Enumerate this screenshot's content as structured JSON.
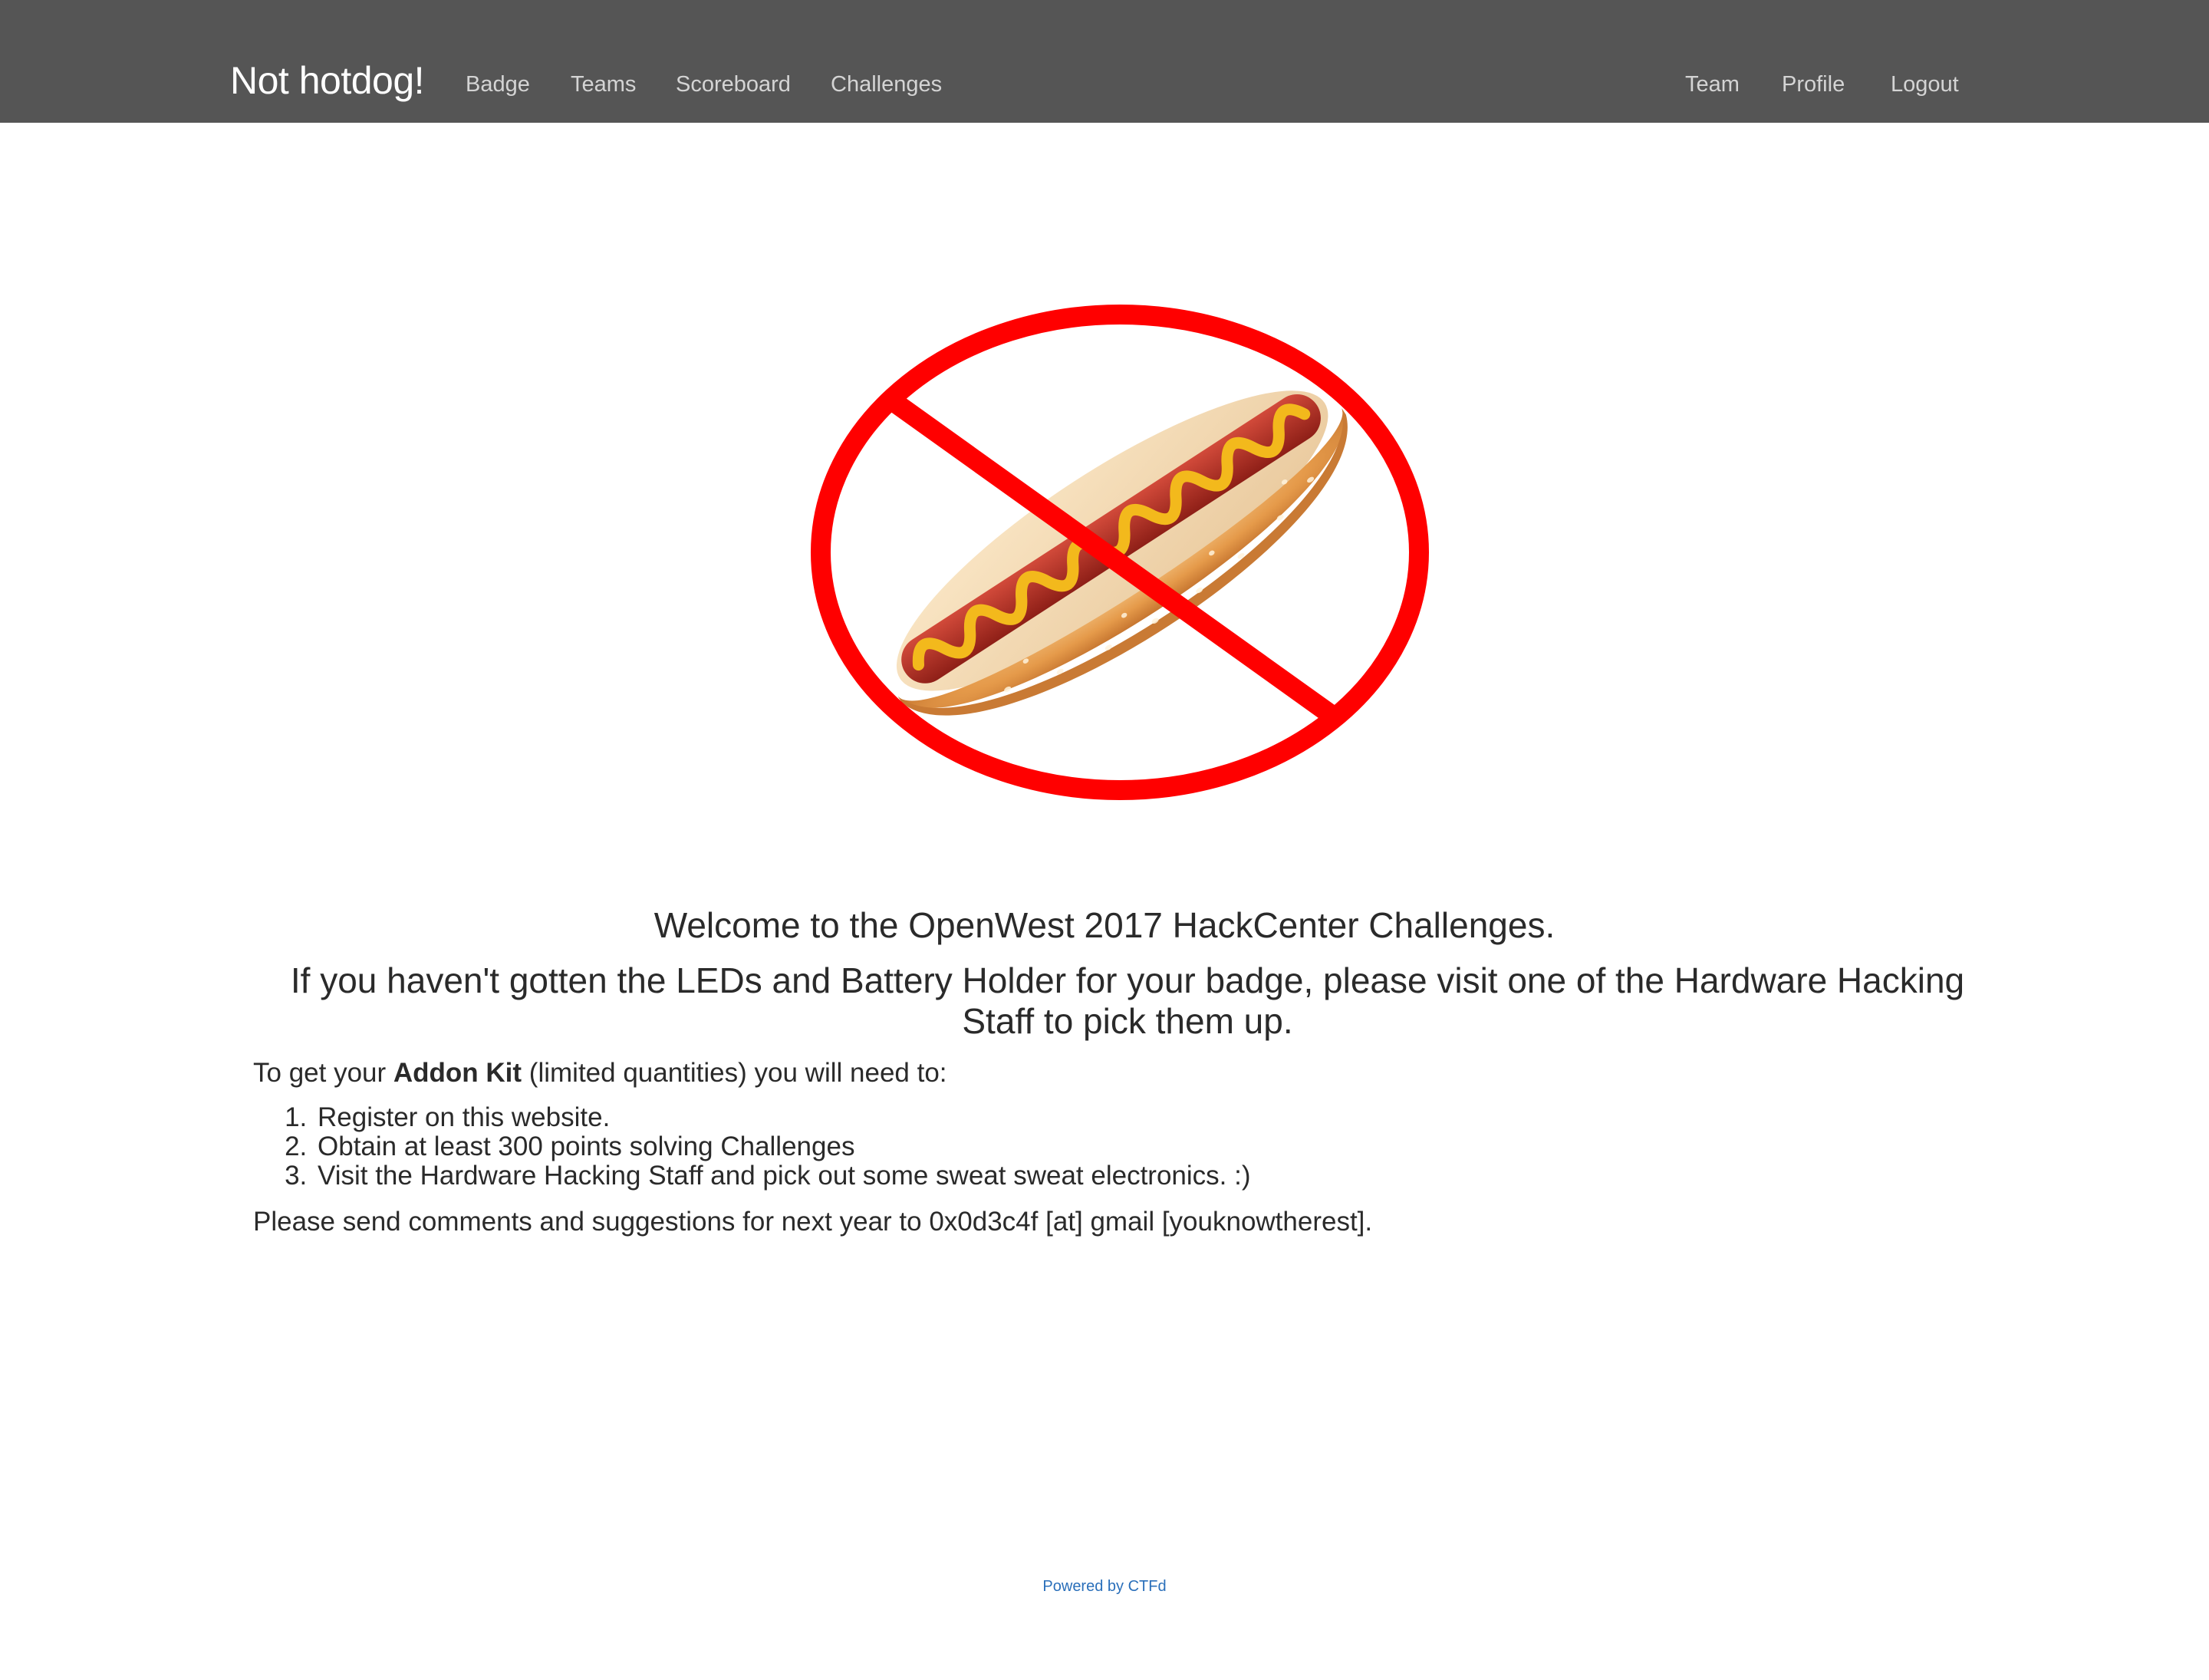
{
  "navbar": {
    "brand": "Not hotdog!",
    "left_links": [
      {
        "label": "Badge"
      },
      {
        "label": "Teams"
      },
      {
        "label": "Scoreboard"
      },
      {
        "label": "Challenges"
      }
    ],
    "right_links": [
      {
        "label": "Team"
      },
      {
        "label": "Profile"
      },
      {
        "label": "Logout"
      }
    ],
    "background_color": "#555555",
    "link_color": "#d4d4d4"
  },
  "hero": {
    "icon": "no-hotdog-prohibition-icon",
    "sign_color": "#ff0000"
  },
  "content": {
    "welcome": "Welcome to the OpenWest 2017 HackCenter Challenges.",
    "instructions": "If you haven't gotten the LEDs and Battery Holder for your badge, please visit one of the Hardware Hacking Staff to pick them up.",
    "kit_prefix": "To get your ",
    "kit_name": "Addon Kit",
    "kit_suffix": " (limited quantities) you will need to:",
    "steps": [
      "Register on this website.",
      "Obtain at least 300 points solving Challenges",
      "Visit the Hardware Hacking Staff and pick out some sweat sweat electronics. :)"
    ],
    "comments": "Please send comments and suggestions for next year to 0x0d3c4f [at] gmail [youknowtherest]."
  },
  "footer": {
    "powered_by": "Powered by CTFd",
    "link_color": "#2a6fba"
  }
}
